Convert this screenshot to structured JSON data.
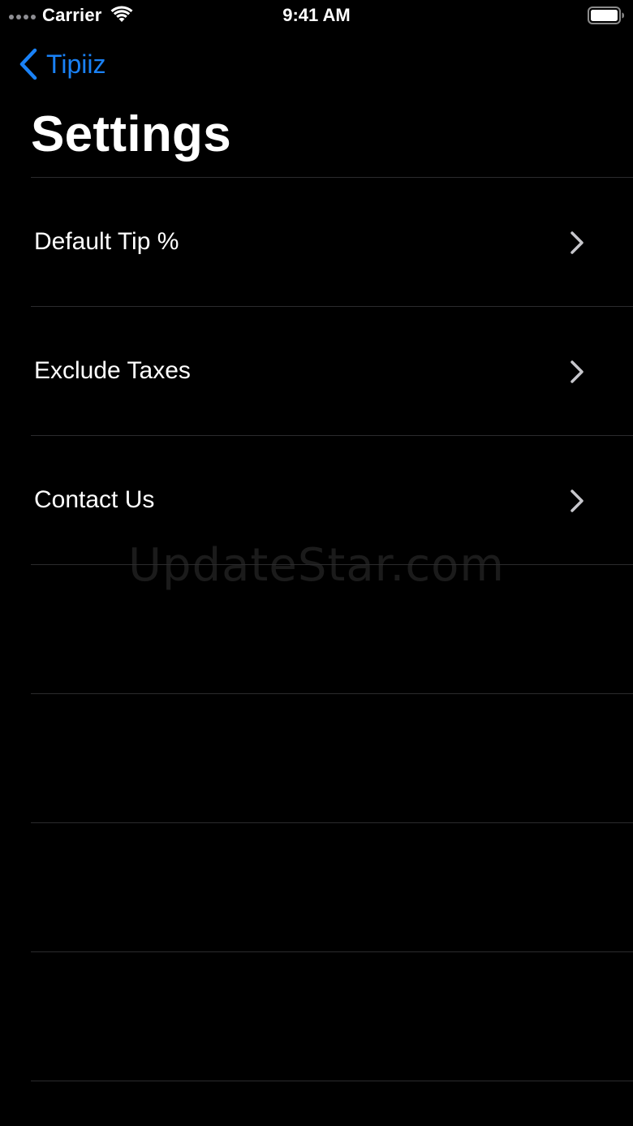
{
  "status_bar": {
    "carrier": "Carrier",
    "time": "9:41 AM",
    "icons": [
      "signal-dots-icon",
      "wifi-icon",
      "battery-icon"
    ]
  },
  "nav": {
    "back_label": "Tipiiz",
    "title": "Settings",
    "accent_color": "#1a82f7"
  },
  "settings": {
    "items": [
      {
        "label": "Default Tip %",
        "icon": "chevron-right-icon"
      },
      {
        "label": "Exclude Taxes",
        "icon": "chevron-right-icon"
      },
      {
        "label": "Contact Us",
        "icon": "chevron-right-icon"
      }
    ],
    "empty_rows": 4
  },
  "watermark": "UpdateStar.com"
}
